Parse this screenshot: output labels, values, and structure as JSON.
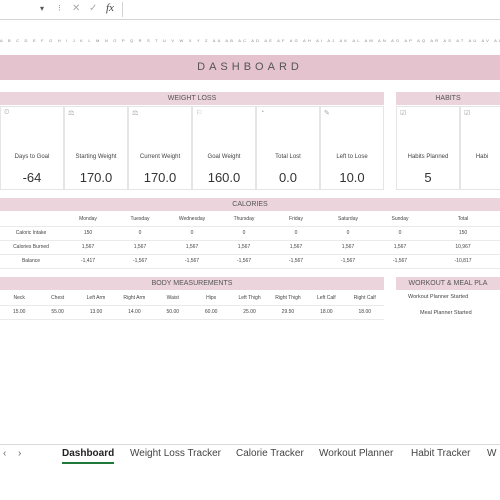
{
  "formula_bar": {
    "dropdown": "▾",
    "sep": "⁝",
    "cancel": "✕",
    "enter": "✓",
    "fx": "fx"
  },
  "col_headers": "A B C D E F G H I J K L M N O P Q R S T U V W X Y Z AA AB AC AD AE AF AG AH AI AJ AK AL AM AN AO AP AQ AR AS AT AU AV AW AX AY AZ",
  "banner": "DASHBOARD",
  "weight_loss": {
    "title": "WEIGHT LOSS",
    "cards": [
      {
        "icon": "⏲",
        "label": "Days to Goal",
        "value": "-64"
      },
      {
        "icon": "⚖",
        "label": "Starting Weight",
        "value": "170.0"
      },
      {
        "icon": "⚖",
        "label": "Current Weight",
        "value": "170.0"
      },
      {
        "icon": "⚐",
        "label": "Goal Weight",
        "value": "160.0"
      },
      {
        "icon": "◔",
        "label": "Total Lost",
        "value": "0.0"
      },
      {
        "icon": "✎",
        "label": "Left to Lose",
        "value": "10.0"
      }
    ]
  },
  "habits": {
    "title": "HABITS",
    "cards": [
      {
        "icon": "☑",
        "label": "Habits Planned",
        "value": "5"
      },
      {
        "icon": "☑",
        "label": "Habi",
        "value": ""
      }
    ]
  },
  "calories": {
    "title": "CALORIES",
    "days": [
      "Monday",
      "Tuesday",
      "Wednesday",
      "Thursday",
      "Friday",
      "Saturday",
      "Sunday",
      "Total"
    ],
    "rows": [
      {
        "label": "Caloric Intake",
        "values": [
          "150",
          "0",
          "0",
          "0",
          "0",
          "0",
          "0",
          "150"
        ]
      },
      {
        "label": "Calories Burned",
        "values": [
          "1,567",
          "1,567",
          "1,567",
          "1,567",
          "1,567",
          "1,567",
          "1,567",
          "10,967"
        ]
      },
      {
        "label": "Balance",
        "values": [
          "-1,417",
          "-1,567",
          "-1,567",
          "-1,567",
          "-1,567",
          "-1,567",
          "-1,567",
          "-10,817"
        ]
      }
    ]
  },
  "body": {
    "title": "BODY MEASUREMENTS",
    "headers": [
      "Neck",
      "Chest",
      "Left Arm",
      "Right Arm",
      "Waist",
      "Hips",
      "Left Thigh",
      "Right Thigh",
      "Left Calf",
      "Right Calf"
    ],
    "values": [
      "15.00",
      "55.00",
      "13.00",
      "14.00",
      "50.00",
      "60.00",
      "25.00",
      "29.50",
      "18.00",
      "18.00"
    ]
  },
  "workout": {
    "title": "WORKOUT & MEAL PLA",
    "lines": [
      "Workout Planner Started",
      "Meal Planner Started"
    ]
  },
  "tabs": {
    "prev": "‹",
    "next": "›",
    "items": [
      "Dashboard",
      "Weight Loss Tracker",
      "Calorie Tracker",
      "Workout Planner",
      "Habit Tracker",
      "W"
    ]
  }
}
